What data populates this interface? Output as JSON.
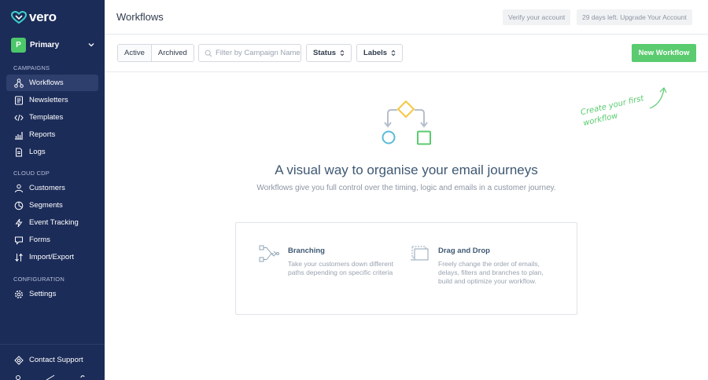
{
  "brand": {
    "name": "vero"
  },
  "workspace": {
    "initial": "P",
    "name": "Primary"
  },
  "sidebar": {
    "sections": [
      {
        "label": "CAMPAIGNS"
      },
      {
        "label": "CLOUD CDP"
      },
      {
        "label": "CONFIGURATION"
      }
    ],
    "items": [
      {
        "label": "Workflows",
        "icon": "workflow-icon",
        "active": true
      },
      {
        "label": "Newsletters",
        "icon": "newsletter-icon"
      },
      {
        "label": "Templates",
        "icon": "code-icon"
      },
      {
        "label": "Reports",
        "icon": "chart-icon"
      },
      {
        "label": "Logs",
        "icon": "document-icon"
      },
      {
        "label": "Customers",
        "icon": "users-icon"
      },
      {
        "label": "Segments",
        "icon": "pie-icon"
      },
      {
        "label": "Event Tracking",
        "icon": "bolt-icon"
      },
      {
        "label": "Forms",
        "icon": "chat-icon"
      },
      {
        "label": "Import/Export",
        "icon": "import-export-icon"
      },
      {
        "label": "Settings",
        "icon": "gear-icon"
      }
    ],
    "support": {
      "label": "Contact Support",
      "icon": "support-icon"
    }
  },
  "header": {
    "title": "Workflows",
    "verify_label": "Verify your account",
    "trial_label": "29 days left. Upgrade Your Account"
  },
  "toolbar": {
    "tabs": [
      {
        "label": "Active"
      },
      {
        "label": "Archived"
      }
    ],
    "search_placeholder": "Filter by Campaign Name",
    "status_label": "Status",
    "labels_label": "Labels",
    "new_label": "New Workflow"
  },
  "empty_state": {
    "hint_line1": "Create your first",
    "hint_line2": "workflow",
    "headline": "A visual way to organise your email journeys",
    "subline": "Workflows give you full control over the timing, logic and emails in a customer journey.",
    "features": [
      {
        "title": "Branching",
        "desc_lines": [
          "Take your customers down different",
          "paths depending on specific criteria"
        ],
        "icon": "branching-icon"
      },
      {
        "title": "Drag and Drop",
        "desc_lines": [
          "Freely change the order of emails,",
          "delays, filters and branches to plan,",
          "build and optimize your workflow."
        ],
        "icon": "drag-drop-icon"
      }
    ]
  },
  "colors": {
    "sidebar_bg": "#1c2c59",
    "accent_green": "#5acb6f",
    "diamond_yellow": "#f5c842",
    "circle_blue": "#5bbcd6"
  }
}
